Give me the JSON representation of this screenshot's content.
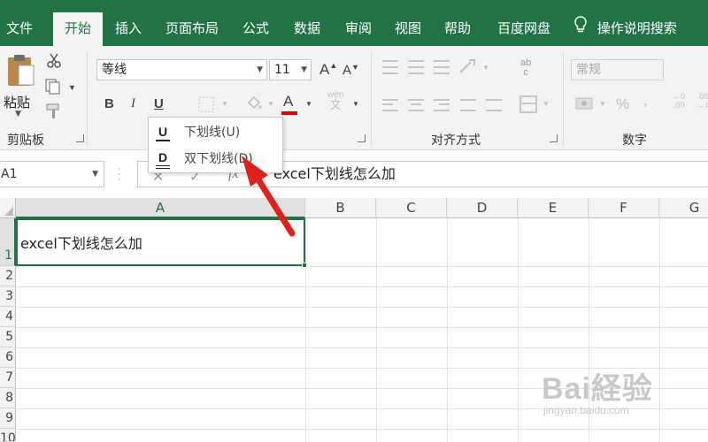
{
  "ribbon_tabs": [
    {
      "label": "文件"
    },
    {
      "label": "开始"
    },
    {
      "label": "插入"
    },
    {
      "label": "页面布局"
    },
    {
      "label": "公式"
    },
    {
      "label": "数据"
    },
    {
      "label": "审阅"
    },
    {
      "label": "视图"
    },
    {
      "label": "帮助"
    },
    {
      "label": "百度网盘"
    }
  ],
  "active_tab": "开始",
  "tell_me": "操作说明搜索",
  "clipboard": {
    "paste_label": "粘贴",
    "group_label": "剪贴板"
  },
  "font": {
    "name": "等线",
    "size": "11",
    "bold": "B",
    "italic": "I",
    "underline": "U",
    "font_color_glyph": "A",
    "grow_glyph": "A",
    "shrink_glyph": "A",
    "phonetic_top": "wén",
    "phonetic_bottom": "文"
  },
  "alignment": {
    "group_label": "对齐方式",
    "orientation_top": "ab",
    "orientation_bottom": "c"
  },
  "number": {
    "format": "常规",
    "group_label": "数字",
    "percent": "%",
    "inc_top": "←0",
    "inc_bottom": ".00",
    "dec_top": ".00",
    "dec_bottom": "→.0"
  },
  "underline_menu": {
    "items": [
      {
        "icon": "U",
        "label": "下划线(U)"
      },
      {
        "icon": "D",
        "label": "双下划线(D)"
      }
    ]
  },
  "formula_bar": {
    "name_box": "A1",
    "fx": "fx",
    "content": "excel下划线怎么加"
  },
  "sheet": {
    "columns": [
      "A",
      "B",
      "C",
      "D",
      "E",
      "F",
      "G"
    ],
    "rows": [
      "1",
      "2",
      "3",
      "4",
      "5",
      "6",
      "7",
      "8",
      "9",
      "10"
    ],
    "cells": {
      "A1": "excel下划线怎么加"
    }
  },
  "watermark": {
    "brand": "Bai経验",
    "url": "jingyan.baidu.com"
  },
  "colors": {
    "accent": "#217346",
    "arrow": "#e0201a",
    "font_color_bar": "#e00000"
  }
}
